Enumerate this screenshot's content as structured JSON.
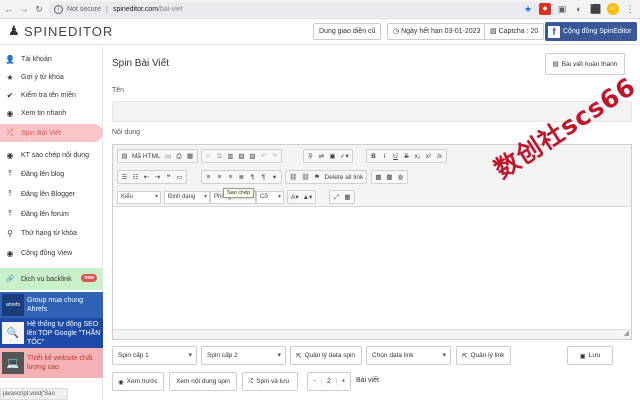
{
  "browser": {
    "security_label": "Not secure",
    "url_host": "spineditor.com",
    "url_path": "/bai-viet"
  },
  "app": {
    "logo_text": "SPINEDITOR",
    "old_ui_label": "Dung giao diện cũ",
    "expiry_label": "Ngày hết hạn 03-01-2023",
    "captcha_label": "Captcha : 20",
    "facebook_label": "Cộng đồng SpinEditor"
  },
  "sidebar": {
    "items": [
      {
        "label": "Tài khoản",
        "icon": "user-icon"
      },
      {
        "label": "Gợi ý từ khóa",
        "icon": "star-icon"
      },
      {
        "label": "Kiểm tra tên miền",
        "icon": "check-icon"
      },
      {
        "label": "Xem tin nhanh",
        "icon": "eye-icon"
      },
      {
        "label": "Spin Bài Viết",
        "icon": "shuffle-icon",
        "active": true
      },
      {
        "label": "KT sao chép nội dung",
        "icon": "eye-icon"
      },
      {
        "label": "Đăng lên blog",
        "icon": "upload-icon"
      },
      {
        "label": "Đăng lên Blogger",
        "icon": "upload-icon"
      },
      {
        "label": "Đăng lên forum",
        "icon": "upload-icon"
      },
      {
        "label": "Thứ hạng từ khóa",
        "icon": "search-icon"
      },
      {
        "label": "Cộng đồng View",
        "icon": "eye-icon"
      }
    ],
    "backlink_label": "Dịch vụ backlink",
    "new_badge": "new",
    "promo1_label": "Group mua chung Ahrefs",
    "promo1_thumb": "ahrefs",
    "promo2_label": "Hệ thống tự động SEO lên TOP Google \"THẦN TỐC\"",
    "promo3_label": "Thiết kế website chất lượng cao"
  },
  "status_bar_text": "javascript:void('Sao chép')",
  "main": {
    "page_title": "Spin Bài Viết",
    "finished_label": "Bài viết hoàn thành",
    "title_label": "Tên",
    "content_label": "Nội dung"
  },
  "editor": {
    "source_label": "Mã HTML",
    "delete_links_label": "Delete all link",
    "tooltip": "Sao chép",
    "format_select": "Kiểu",
    "style_select": "Định dạng",
    "font_select": "Phông",
    "size_select": "Cỡ"
  },
  "watermark_text": "数创社scs66",
  "controls": {
    "spin_level_1": "Spin cấp 1",
    "spin_level_2": "Spin cấp 2",
    "manage_data_spin": "Quản lý data spin",
    "choose_data_link": "Chọn data link",
    "manage_link": "Quản lý link",
    "save": "Lưu",
    "preview": "Xem trước",
    "view_spin_content": "Xem nội dung spin",
    "spin_and_save": "Spin và lưu",
    "stepper_minus": "-",
    "stepper_value": "2",
    "stepper_plus": "+",
    "articles_label": "Bài viết"
  }
}
